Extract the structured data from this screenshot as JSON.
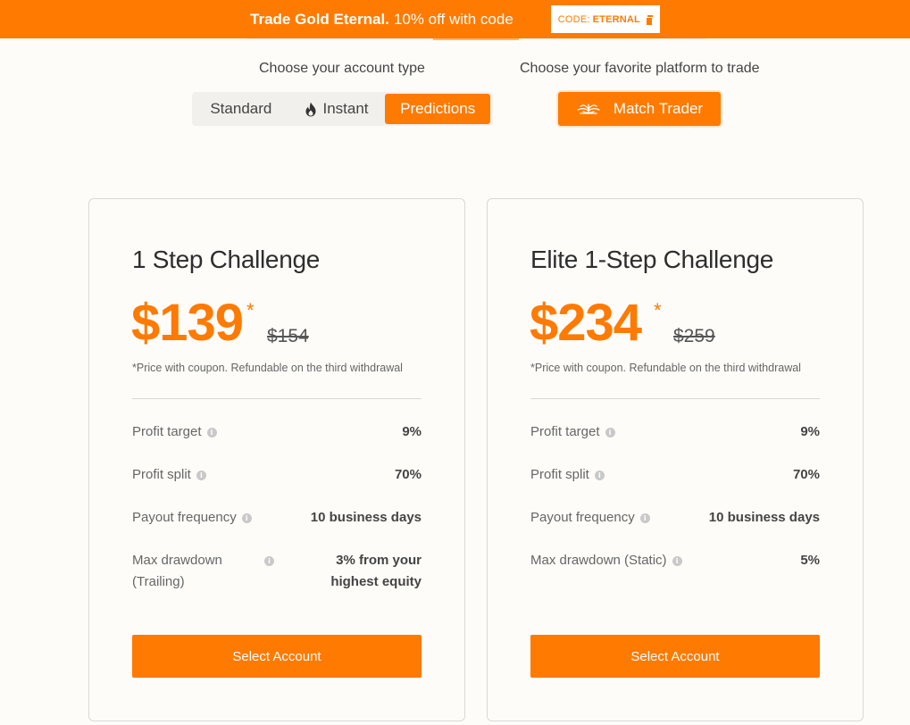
{
  "banner": {
    "headline": "Trade Gold Eternal.",
    "promo": "10% off with code",
    "code_label": "CODE:",
    "code_value": "ETERNAL"
  },
  "account_type": {
    "label": "Choose your account type",
    "options": [
      "Standard",
      "Instant",
      "Predictions"
    ],
    "selected": "Predictions"
  },
  "platform": {
    "label": "Choose your favorite platform to trade",
    "selected": "Match Trader"
  },
  "cards": [
    {
      "title": "1 Step Challenge",
      "price": "$139",
      "asterisk": "*",
      "old_price": "$154",
      "note": "*Price with coupon. Refundable on the third withdrawal",
      "rows": [
        {
          "label": "Profit target",
          "value": "9%"
        },
        {
          "label": "Profit split",
          "value": "70%"
        },
        {
          "label": "Payout frequency",
          "value": "10 business days"
        },
        {
          "label_line1": "Max drawdown",
          "label_line2": "(Trailing)",
          "value_line1": "3% from your",
          "value_line2": "highest equity"
        }
      ],
      "button": "Select Account"
    },
    {
      "title": "Elite 1-Step Challenge",
      "price": "$234",
      "asterisk": "*",
      "old_price": "$259",
      "note": "*Price with coupon. Refundable on the third withdrawal",
      "rows": [
        {
          "label": "Profit target",
          "value": "9%"
        },
        {
          "label": "Profit split",
          "value": "70%"
        },
        {
          "label": "Payout frequency",
          "value": "10 business days"
        },
        {
          "label": "Max drawdown (Static)",
          "value": "5%"
        }
      ],
      "button": "Select Account"
    }
  ],
  "colors": {
    "accent": "#ff7a00",
    "background": "#fdfcf8"
  },
  "icons": {
    "info": "info-icon",
    "copy": "copy-icon",
    "flame": "flame-icon",
    "platform_logo": "match-trader-logo-icon"
  }
}
